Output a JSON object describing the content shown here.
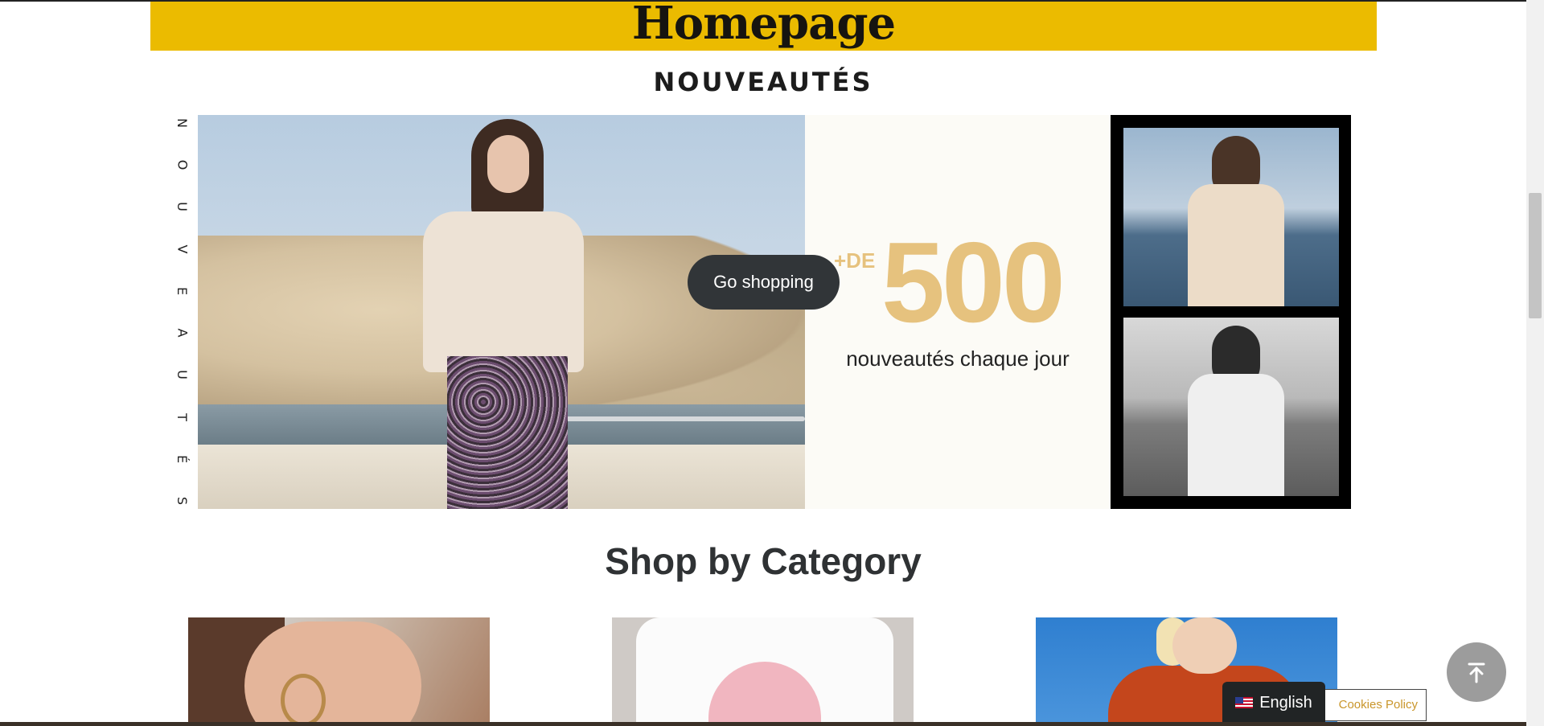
{
  "hero": {
    "title": "Homepage",
    "background_color": "#ebbb00"
  },
  "new_arrivals": {
    "heading": "NOUVEAUTÉS",
    "vertical_letters": [
      "N",
      "O",
      "U",
      "V",
      "E",
      "A",
      "U",
      "T",
      "É",
      "S"
    ],
    "go_shopping_label": "Go shopping",
    "promo_prefix": "+DE",
    "promo_number": "500",
    "promo_caption": "nouveautés chaque jour",
    "accent_color": "#e6c27e"
  },
  "category_section": {
    "title": "Shop by Category"
  },
  "widgets": {
    "cookies_label": "Cookies Policy",
    "language_label": "English",
    "scroll_top_icon": "arrow-up-to-line-icon"
  }
}
